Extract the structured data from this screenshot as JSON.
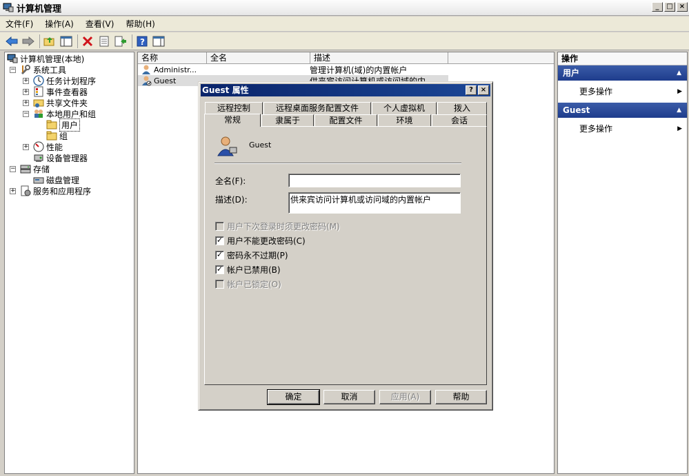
{
  "window": {
    "title": "计算机管理",
    "controls": [
      "_",
      "□",
      "×"
    ]
  },
  "menubar": {
    "items": [
      "文件(F)",
      "操作(A)",
      "查看(V)",
      "帮助(H)"
    ]
  },
  "toolbar": {
    "icons": [
      "back-arrow-icon",
      "forward-arrow-icon",
      "up-folder-icon",
      "show-hide-tree-icon",
      "delete-icon",
      "properties-icon",
      "export-list-icon",
      "help-icon",
      "show-action-pane-icon"
    ]
  },
  "tree": {
    "root": "计算机管理(本地)",
    "items": [
      {
        "label": "系统工具",
        "expander": "−"
      },
      {
        "label": "任务计划程序",
        "expander": "+"
      },
      {
        "label": "事件查看器",
        "expander": "+"
      },
      {
        "label": "共享文件夹",
        "expander": "+"
      },
      {
        "label": "本地用户和组",
        "expander": "−"
      },
      {
        "label": "用户",
        "expander": ""
      },
      {
        "label": "组",
        "expander": ""
      },
      {
        "label": "性能",
        "expander": "+"
      },
      {
        "label": "设备管理器",
        "expander": ""
      },
      {
        "label": "存储",
        "expander": "−"
      },
      {
        "label": "磁盘管理",
        "expander": ""
      },
      {
        "label": "服务和应用程序",
        "expander": "+"
      }
    ]
  },
  "list": {
    "columns": [
      "名称",
      "全名",
      "描述"
    ],
    "rows": [
      {
        "name": "Administr...",
        "fullname": "",
        "desc": "管理计算机(域)的内置帐户"
      },
      {
        "name": "Guest",
        "fullname": "",
        "desc": "供来宾访问计算机或访问域的内..."
      }
    ]
  },
  "actions": {
    "header": "操作",
    "sections": [
      {
        "title": "用户",
        "item": "更多操作"
      },
      {
        "title": "Guest",
        "item": "更多操作"
      }
    ]
  },
  "dialog": {
    "title": "Guest 属性",
    "title_buttons": [
      "?",
      "×"
    ],
    "tabs_back": [
      "远程控制",
      "远程桌面服务配置文件",
      "个人虚拟机",
      "拨入"
    ],
    "tabs_front": [
      "常规",
      "隶属于",
      "配置文件",
      "环境",
      "会话"
    ],
    "username": "Guest",
    "fullname_label": "全名(F):",
    "fullname_value": "",
    "desc_label": "描述(D):",
    "desc_value": "供来宾访问计算机或访问域的内置帐户",
    "checkboxes": [
      {
        "label": "用户下次登录时须更改密码(M)",
        "checked": false,
        "disabled": true
      },
      {
        "label": "用户不能更改密码(C)",
        "checked": true,
        "disabled": false
      },
      {
        "label": "密码永不过期(P)",
        "checked": true,
        "disabled": false
      },
      {
        "label": "帐户已禁用(B)",
        "checked": true,
        "disabled": false
      },
      {
        "label": "帐户已锁定(O)",
        "checked": false,
        "disabled": true
      }
    ],
    "buttons": {
      "ok": "确定",
      "cancel": "取消",
      "apply": "应用(A)",
      "help": "帮助"
    }
  }
}
